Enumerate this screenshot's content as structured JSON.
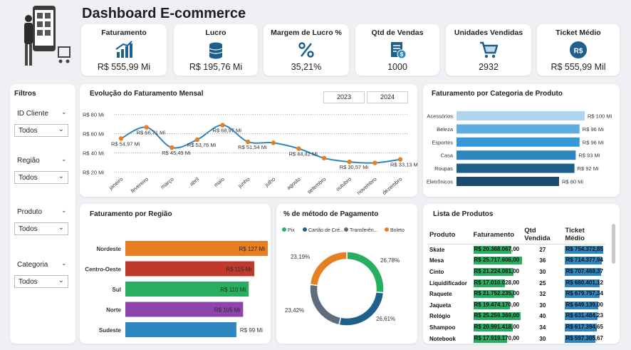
{
  "header": {
    "title": "Dashboard E-commerce"
  },
  "kpis": [
    {
      "title": "Faturamento",
      "value": "R$ 555,99 Mi",
      "icon": "growth-chart-icon"
    },
    {
      "title": "Lucro",
      "value": "R$ 195,76 Mi",
      "icon": "coins-stack-icon"
    },
    {
      "title": "Margem de Lucro %",
      "value": "35,21%",
      "icon": "percent-icon"
    },
    {
      "title": "Qtd de Vendas",
      "value": "1000",
      "icon": "invoice-icon"
    },
    {
      "title": "Unidades Vendidas",
      "value": "2932",
      "icon": "shopping-cart-icon"
    },
    {
      "title": "Ticket Médio",
      "value": "R$ 555,99 Mil",
      "icon": "currency-badge-icon"
    }
  ],
  "filters": {
    "title": "Filtros",
    "items": [
      {
        "label": "ID Cliente",
        "value": "Todos"
      },
      {
        "label": "Região",
        "value": "Todos"
      },
      {
        "label": "Produto",
        "value": "Todos"
      },
      {
        "label": "Categoria",
        "value": "Todos"
      }
    ]
  },
  "monthly": {
    "title": "Evolução do Faturamento Mensal",
    "years": [
      "2023",
      "2024"
    ]
  },
  "category": {
    "title": "Faturamento por Categoria de Produto"
  },
  "region": {
    "title": "Faturamento por Região"
  },
  "payment": {
    "title": "% de  método de Pagamento"
  },
  "products": {
    "title": "Lista de Produtos",
    "columns": [
      "Produto",
      "Faturamento",
      "Qtd Vendida",
      "Ticket Médio"
    ],
    "rows": [
      {
        "name": "Skate",
        "revenue": "R$ 20.368.067,00",
        "rev_pct": 0.79,
        "qty": "27",
        "ticket": "R$ 754.372,85",
        "ticket_pct": 1.0
      },
      {
        "name": "Mesa",
        "revenue": "R$ 25.717.606,00",
        "rev_pct": 1.0,
        "qty": "36",
        "ticket": "R$ 714.377,94",
        "ticket_pct": 0.95
      },
      {
        "name": "Cinto",
        "revenue": "R$ 21.224.081,00",
        "rev_pct": 0.83,
        "qty": "30",
        "ticket": "R$ 707.469,37",
        "ticket_pct": 0.94
      },
      {
        "name": "Liquidificador",
        "revenue": "R$ 17.010.028,00",
        "rev_pct": 0.66,
        "qty": "25",
        "ticket": "R$ 680.401,12",
        "ticket_pct": 0.9
      },
      {
        "name": "Raquete",
        "revenue": "R$ 21.752.235,00",
        "rev_pct": 0.85,
        "qty": "32",
        "ticket": "R$ 679.757,34",
        "ticket_pct": 0.9
      },
      {
        "name": "Jaqueta",
        "revenue": "R$ 19.474.170,00",
        "rev_pct": 0.76,
        "qty": "30",
        "ticket": "R$ 649.139,00",
        "ticket_pct": 0.86
      },
      {
        "name": "Relógio",
        "revenue": "R$ 25.259.369,00",
        "rev_pct": 0.98,
        "qty": "40",
        "ticket": "R$ 631.484,23",
        "ticket_pct": 0.84
      },
      {
        "name": "Shampoo",
        "revenue": "R$ 20.991.418,00",
        "rev_pct": 0.82,
        "qty": "34",
        "ticket": "R$ 617.394,65",
        "ticket_pct": 0.82
      },
      {
        "name": "Notebook",
        "revenue": "R$ 17.919.170,00",
        "rev_pct": 0.7,
        "qty": "30",
        "ticket": "R$ 597.305,67",
        "ticket_pct": 0.79
      }
    ]
  },
  "chart_data": [
    {
      "type": "line",
      "title": "Evolução do Faturamento Mensal",
      "categories": [
        "janeiro",
        "fevereiro",
        "março",
        "abril",
        "maio",
        "junho",
        "julho",
        "agosto",
        "setembro",
        "outubro",
        "novembro",
        "dezembro"
      ],
      "values": [
        54.97,
        66.71,
        45.49,
        53.76,
        68.97,
        51.54,
        50.5,
        44.42,
        34.5,
        30.57,
        29.5,
        33.13
      ],
      "labels": [
        "R$ 54,97 Mi",
        "R$ 66,71 Mi",
        "R$ 45,49 Mi",
        "R$ 53,76 Mi",
        "R$ 68,97 Mi",
        "R$ 51,54 Mi",
        "",
        "R$ 44,42 Mi",
        "",
        "R$ 30,57 Mi",
        "",
        "R$ 33,13 Mi"
      ],
      "ytick_labels": [
        "R$ 80 Mi",
        "R$ 60 Mi",
        "R$ 40 Mi",
        "R$ 20 Mi"
      ],
      "yticks": [
        80,
        60,
        40,
        20
      ],
      "ylim": [
        15,
        85
      ],
      "color": "#2e86c1",
      "marker_color": "#e67e22"
    },
    {
      "type": "bar",
      "orientation": "horizontal",
      "title": "Faturamento por Categoria de Produto",
      "categories": [
        "Acessórios",
        "Beleza",
        "Esportes",
        "Casa",
        "Roupas",
        "Eletrônicos"
      ],
      "values": [
        100,
        96,
        96,
        93,
        92,
        80
      ],
      "labels": [
        "R$ 100 Mi",
        "R$ 96 Mi",
        "R$ 96 Mi",
        "R$ 93 Mi",
        "R$ 92 Mi",
        "R$ 80 Mi"
      ],
      "colors": [
        "#aed6f1",
        "#5dade2",
        "#3498db",
        "#2e86c1",
        "#1f5f8b",
        "#1a4a6e"
      ]
    },
    {
      "type": "bar",
      "orientation": "horizontal",
      "title": "Faturamento por Região",
      "categories": [
        "Nordeste",
        "Centro-Oeste",
        "Sul",
        "Norte",
        "Sudeste"
      ],
      "values": [
        127,
        115,
        110,
        105,
        99
      ],
      "labels": [
        "R$ 127 Mi",
        "R$ 115 Mi",
        "R$ 110 Mi",
        "R$ 105 Mi",
        "R$ 99 Mi"
      ],
      "colors": [
        "#e67e22",
        "#c0392b",
        "#27ae60",
        "#8e44ad",
        "#2e86c1"
      ]
    },
    {
      "type": "pie",
      "title": "% de  método de Pagamento",
      "categories": [
        "Pix",
        "Cartão de Cré...",
        "Transferên...",
        "Boleto"
      ],
      "values": [
        26.78,
        26.61,
        23.42,
        23.19
      ],
      "labels": [
        "26,78%",
        "26,61%",
        "23,42%",
        "23,19%"
      ],
      "colors": [
        "#27ae60",
        "#1f5f8b",
        "#5d6d7e",
        "#e67e22"
      ]
    }
  ]
}
